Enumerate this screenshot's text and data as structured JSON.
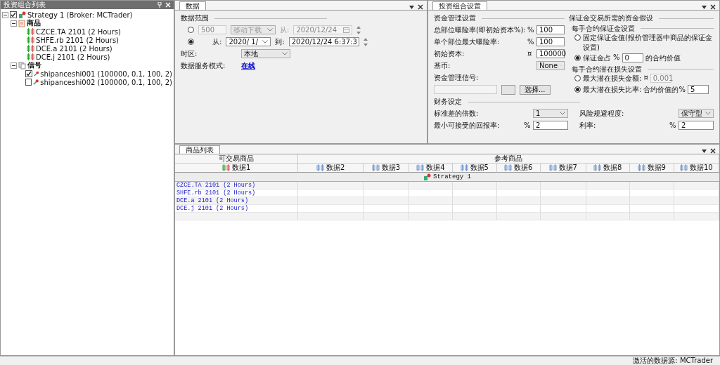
{
  "left_panel": {
    "title": "投资组合列表",
    "tree": [
      {
        "label": "Strategy 1 (Broker: MCTrader)",
        "kind": "strategy",
        "checked": true,
        "expanded": true,
        "children": [
          {
            "label": "商品",
            "kind": "folder",
            "expanded": true,
            "children": [
              {
                "label": "CZCE.TA 2101 (2 Hours)",
                "kind": "instrument"
              },
              {
                "label": "SHFE.rb 2101 (2 Hours)",
                "kind": "instrument"
              },
              {
                "label": "DCE.a 2101 (2 Hours)",
                "kind": "instrument"
              },
              {
                "label": "DCE.j 2101 (2 Hours)",
                "kind": "instrument"
              }
            ]
          },
          {
            "label": "信号",
            "kind": "signals",
            "expanded": true,
            "children": [
              {
                "label": "shipanceshi001 (100000, 0.1, 100, 2)",
                "kind": "signal",
                "checked": true
              },
              {
                "label": "shipanceshi002 (100000, 0.1, 100, 2)",
                "kind": "signal",
                "checked": false
              }
            ]
          }
        ]
      }
    ]
  },
  "data_panel": {
    "tab": "数据",
    "section": "数据范围",
    "range_rows": [
      {
        "selected": false,
        "count": "500",
        "mode": "移动下载",
        "from_label": "从:",
        "from": "2020/12/24"
      },
      {
        "selected": true,
        "from_label": "从:",
        "from": "2020/ 1/",
        "to_label": "到:",
        "to": "2020/12/24  6:37:3"
      }
    ],
    "timezone_label": "时区:",
    "timezone": "本地",
    "service_label": "数据服务模式:",
    "service_link": "在线"
  },
  "settings_panel": {
    "tab": "投资组合设置",
    "money": {
      "title": "资金管理设置",
      "fields": [
        {
          "label": "总部位曝险率(即初始资本%):",
          "unit": "%",
          "value": "100"
        },
        {
          "label": "单个部位最大曝险率:",
          "unit": "%",
          "value": "100"
        },
        {
          "label": "初始资本:",
          "unit": "¤",
          "value": "100000"
        }
      ],
      "currency_label": "基币:",
      "currency": "None",
      "signal_label": "资金管理信号:",
      "select_button": "选择..."
    },
    "margin": {
      "title": "保证金交易所需的资金假设",
      "groups": [
        {
          "title": "每手合约保证金设置",
          "options": [
            {
              "kind": "plain",
              "selected": false,
              "label": "固定保证金值(报价管理器中商品的保证金设置)"
            },
            {
              "kind": "input",
              "selected": true,
              "label": "保证金占",
              "unit": "%",
              "value": "0",
              "suffix": "的合约价值"
            }
          ]
        },
        {
          "title": "每手合约潜在损失设置",
          "options": [
            {
              "kind": "input",
              "selected": false,
              "label": "最大潜在损失金额:",
              "unit": "¤",
              "value": "0.001"
            },
            {
              "kind": "input",
              "selected": true,
              "label": "最大潜在损失比率:",
              "unit": "合约价值的%",
              "value": "5"
            }
          ]
        }
      ]
    },
    "finance": {
      "title": "财务设定",
      "rows": [
        {
          "kind": "dropdown",
          "label": "标准差的倍数:",
          "value": "1"
        },
        {
          "kind": "dropdown",
          "label": "风险规避程度:",
          "value": "保守型"
        },
        {
          "kind": "input",
          "label": "最小可接受的回报率:",
          "unit": "%",
          "value": "2"
        },
        {
          "kind": "input",
          "label": "利率:",
          "unit": "%",
          "value": "2"
        }
      ]
    }
  },
  "symbols_panel": {
    "tab": "商品列表",
    "groups": [
      "可交易商品",
      "参考商品"
    ],
    "columns": [
      "数据1",
      "数据2",
      "数据3",
      "数据4",
      "数据5",
      "数据6",
      "数据7",
      "数据8",
      "数据9",
      "数据10"
    ],
    "strategy": "Strategy 1",
    "rows": [
      "CZCE.TA 2101 (2 Hours)",
      "SHFE.rb 2101 (2 Hours)",
      "DCE.a 2101 (2 Hours)",
      "DCE.j 2101 (2 Hours)"
    ]
  },
  "status_bar": "激活的数据源: MCTrader"
}
